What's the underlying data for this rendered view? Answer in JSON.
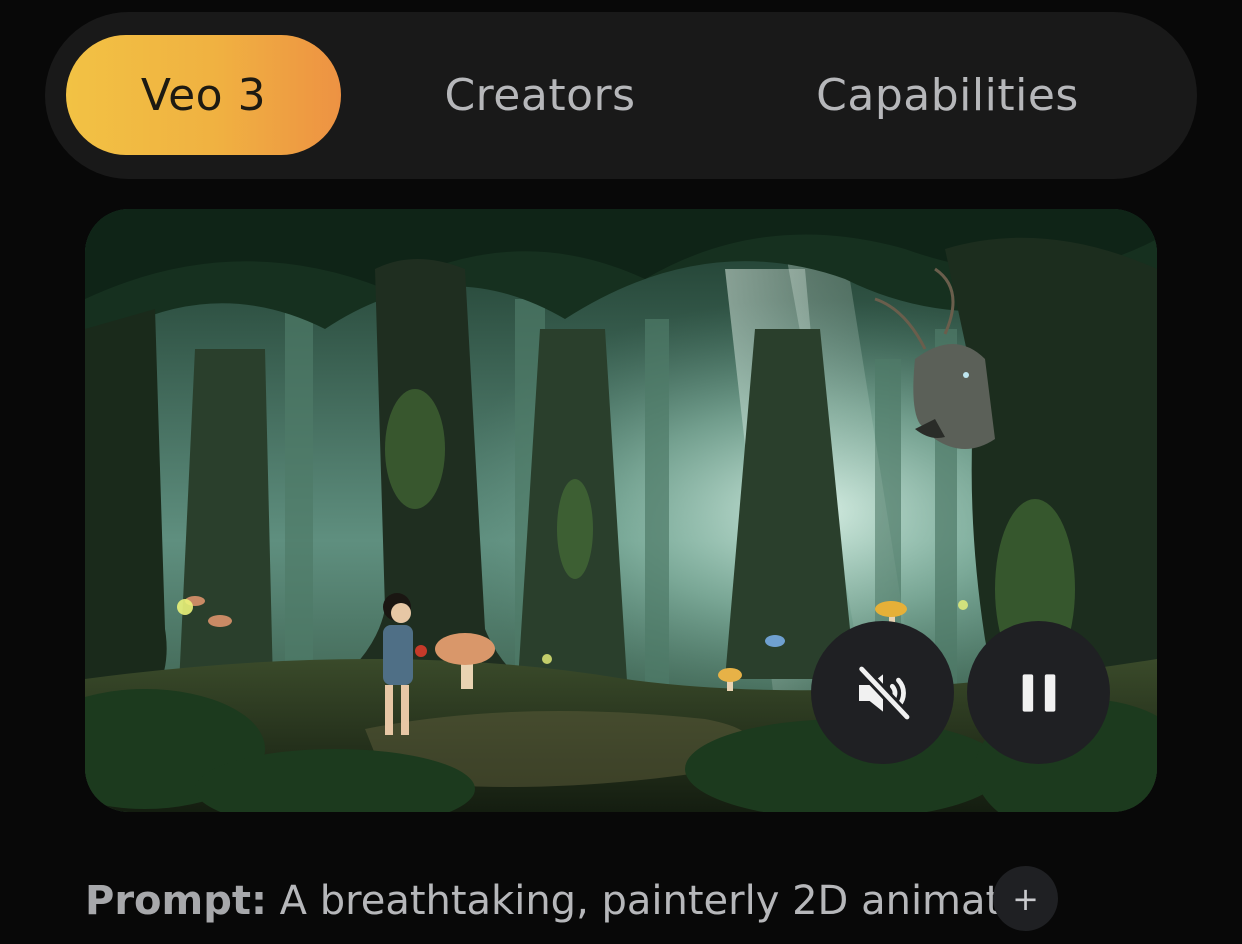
{
  "tabs": [
    {
      "label": "Veo 3",
      "active": true
    },
    {
      "label": "Creators",
      "active": false
    },
    {
      "label": "Capabilities",
      "active": false
    }
  ],
  "colors": {
    "background": "#080808",
    "tabbar": "#191919",
    "active_gradient_start": "#f2c244",
    "active_gradient_end": "#ed9243",
    "inactive_text": "#b6b7ba",
    "control_bg": "#1f2023"
  },
  "video": {
    "mute_icon": "volume-off-icon",
    "pause_icon": "pause-icon"
  },
  "prompt": {
    "label": "Prompt:",
    "text": " A breathtaking, painterly 2D animat...",
    "expand_label": "+",
    "expand_icon": "plus-icon"
  }
}
